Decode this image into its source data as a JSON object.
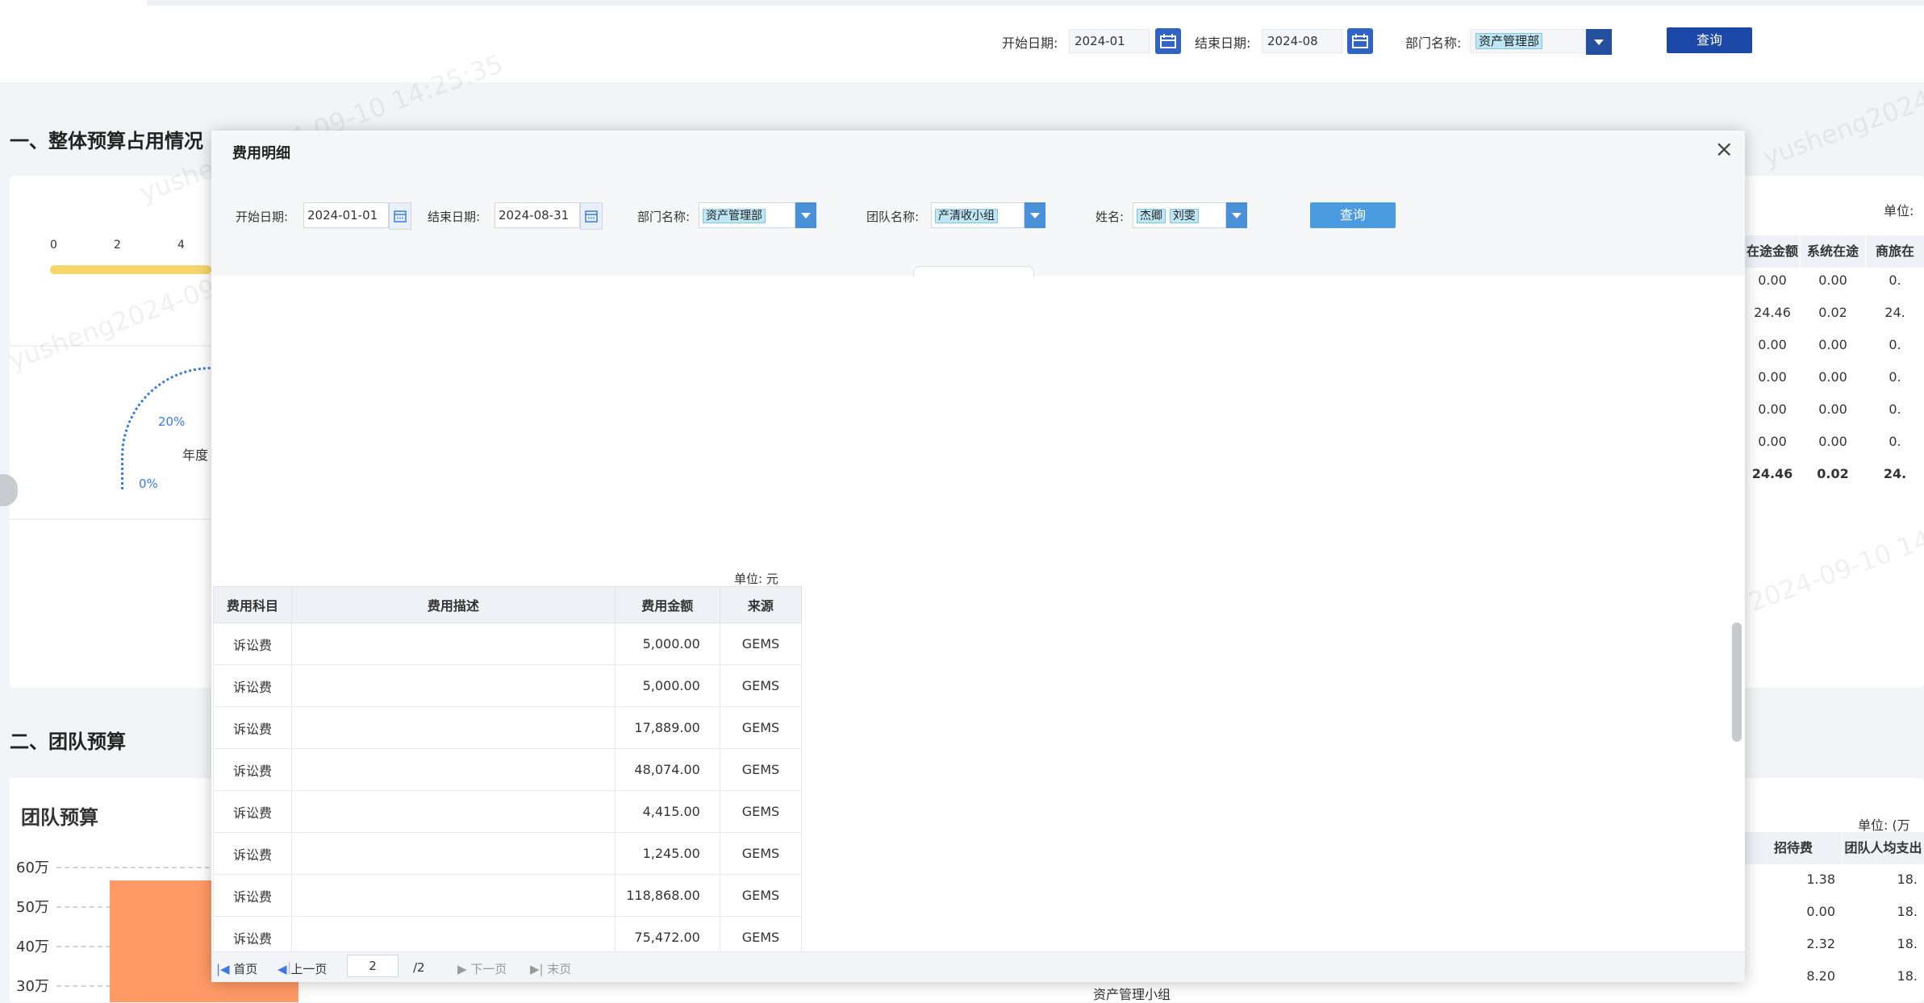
{
  "topbar": {
    "start_label": "开始日期:",
    "start_value": "2024-01",
    "end_label": "结束日期:",
    "end_value": "2024-08",
    "dept_label": "部门名称:",
    "dept_value": "资产管理部",
    "query_label": "查询"
  },
  "page": {
    "section1_title": "一、整体预算占用情况",
    "section2_title": "二、团队预算",
    "team_budget_title": "团队预算",
    "gauge_ticks": [
      "0",
      "2",
      "4"
    ],
    "gauge_pcts": [
      "20%",
      "0%"
    ],
    "gauge_label": "年度",
    "right_unit_1": "单位:",
    "right_headers_1": [
      "在途金额",
      "系统在途",
      "商旅在"
    ],
    "right_rows_1": [
      [
        "0.00",
        "0.00",
        "0."
      ],
      [
        "24.46",
        "0.02",
        "24."
      ],
      [
        "0.00",
        "0.00",
        "0."
      ],
      [
        "0.00",
        "0.00",
        "0."
      ],
      [
        "0.00",
        "0.00",
        "0."
      ],
      [
        "0.00",
        "0.00",
        "0."
      ],
      [
        "24.46",
        "0.02",
        "24."
      ]
    ],
    "right_unit_2": "单位: (万",
    "right_headers_2": [
      "招待费",
      "团队人均支出"
    ],
    "right_rows_2": [
      [
        "1.38",
        "18."
      ],
      [
        "0.00",
        "18."
      ],
      [
        "2.32",
        "18."
      ],
      [
        "8.20",
        "18."
      ]
    ],
    "bottom_row_label": "资产管理小组",
    "y_ticks": [
      "60万",
      "50万",
      "40万",
      "30万"
    ]
  },
  "modal": {
    "title": "费用明细",
    "close": "×",
    "start_label": "开始日期:",
    "start_value": "2024-01-01",
    "end_label": "结束日期:",
    "end_value": "2024-08-31",
    "dept_label": "部门名称:",
    "dept_value": "资产管理部",
    "team_label": "团队名称:",
    "team_value": "产清收小组",
    "name_label": "姓名:",
    "name_values": [
      "杰卿",
      "刘雯"
    ],
    "query_label": "查询",
    "unit": "单位: 元",
    "table": {
      "headers": [
        "费用科目",
        "费用描述",
        "费用金额",
        "来源"
      ],
      "rows": [
        [
          "诉讼费",
          "",
          "5,000.00",
          "GEMS"
        ],
        [
          "诉讼费",
          "",
          "5,000.00",
          "GEMS"
        ],
        [
          "诉讼费",
          "",
          "17,889.00",
          "GEMS"
        ],
        [
          "诉讼费",
          "",
          "48,074.00",
          "GEMS"
        ],
        [
          "诉讼费",
          "",
          "4,415.00",
          "GEMS"
        ],
        [
          "诉讼费",
          "",
          "1,245.00",
          "GEMS"
        ],
        [
          "诉讼费",
          "",
          "118,868.00",
          "GEMS"
        ],
        [
          "诉讼费",
          "",
          "75,472.00",
          "GEMS"
        ]
      ]
    },
    "pager": {
      "first": "首页",
      "prev": "上一页",
      "page_value": "2",
      "total": "/2",
      "next": "下一页",
      "last": "末页"
    }
  },
  "colors": {
    "navy": "#1b47a6",
    "modal_accent": "#4a9be0",
    "bar_orange": "#ff9a66",
    "gauge_yellow": "#f6d56b"
  }
}
